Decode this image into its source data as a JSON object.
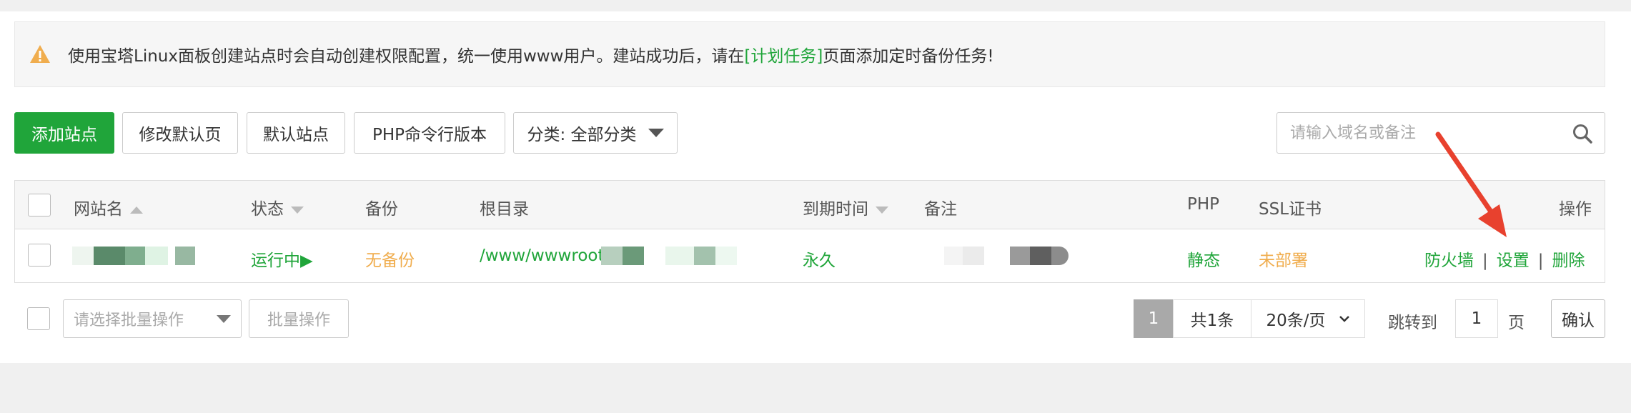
{
  "notice": {
    "text_before": "使用宝塔Linux面板创建站点时会自动创建权限配置，统一使用www用户。建站成功后，请在",
    "link_text": "[计划任务]",
    "text_after": "页面添加定时备份任务!"
  },
  "toolbar": {
    "add_site": "添加站点",
    "modify_default_page": "修改默认页",
    "default_site": "默认站点",
    "php_cli_version": "PHP命令行版本",
    "category_select": "分类: 全部分类"
  },
  "search": {
    "placeholder": "请输入域名或备注"
  },
  "table": {
    "headers": {
      "site_name": "网站名",
      "status": "状态",
      "backup": "备份",
      "root_dir": "根目录",
      "expire": "到期时间",
      "remark": "备注",
      "php": "PHP",
      "ssl": "SSL证书",
      "actions": "操作"
    },
    "rows": [
      {
        "status": "运行中▶",
        "backup": "无备份",
        "root_dir": "/www/wwwroot/",
        "expire": "永久",
        "php": "静态",
        "ssl": "未部署",
        "action_firewall": "防火墙",
        "action_settings": "设置",
        "action_delete": "删除",
        "separator": "|"
      }
    ]
  },
  "footer": {
    "batch_placeholder": "请选择批量操作",
    "batch_button": "批量操作",
    "current_page": "1",
    "total": "共1条",
    "per_page": "20条/页",
    "jump_to": "跳转到",
    "page_input": "1",
    "page_unit": "页",
    "confirm": "确认"
  },
  "colors": {
    "accent_green": "#20a53a",
    "warning_orange": "#f0ad4e",
    "arrow_red": "#e8412e"
  }
}
